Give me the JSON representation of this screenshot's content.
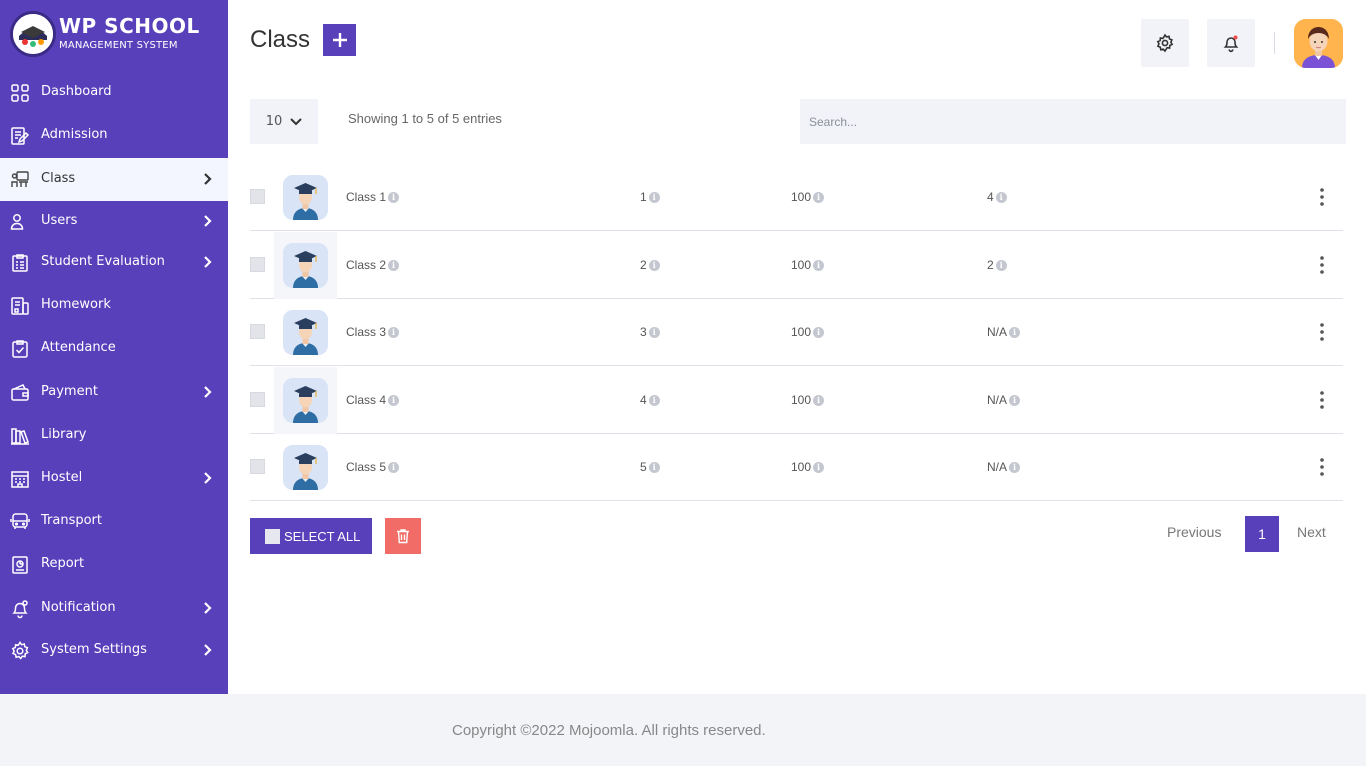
{
  "brand": {
    "title": "WP SCHOOL",
    "subtitle": "MANAGEMENT SYSTEM"
  },
  "sidebar": {
    "items": [
      {
        "label": "Dashboard",
        "icon": "grid-icon",
        "has_submenu": false,
        "active": false
      },
      {
        "label": "Admission",
        "icon": "edit-document-icon",
        "has_submenu": false,
        "active": false
      },
      {
        "label": "Class",
        "icon": "classroom-icon",
        "has_submenu": true,
        "active": true
      },
      {
        "label": "Users",
        "icon": "user-icon",
        "has_submenu": true,
        "active": false
      },
      {
        "label": "Student Evaluation",
        "icon": "clipboard-list-icon",
        "has_submenu": true,
        "active": false
      },
      {
        "label": "Homework",
        "icon": "homework-icon",
        "has_submenu": false,
        "active": false
      },
      {
        "label": "Attendance",
        "icon": "clipboard-check-icon",
        "has_submenu": false,
        "active": false
      },
      {
        "label": "Payment",
        "icon": "wallet-icon",
        "has_submenu": true,
        "active": false
      },
      {
        "label": "Library",
        "icon": "books-icon",
        "has_submenu": false,
        "active": false
      },
      {
        "label": "Hostel",
        "icon": "building-icon",
        "has_submenu": true,
        "active": false
      },
      {
        "label": "Transport",
        "icon": "bus-icon",
        "has_submenu": false,
        "active": false
      },
      {
        "label": "Report",
        "icon": "report-icon",
        "has_submenu": false,
        "active": false
      },
      {
        "label": "Notification",
        "icon": "bell-icon",
        "has_submenu": true,
        "active": false
      },
      {
        "label": "System Settings",
        "icon": "gear-icon",
        "has_submenu": true,
        "active": false
      }
    ]
  },
  "header": {
    "title": "Class",
    "add_icon": "plus-icon",
    "settings_icon": "gear-icon",
    "notification_icon": "bell-icon"
  },
  "table_controls": {
    "page_length": "10",
    "info": "Showing 1 to 5 of 5 entries",
    "search_placeholder": "Search..."
  },
  "rows": [
    {
      "name": "Class 1",
      "numeric": "1",
      "capacity": "100",
      "students": "4"
    },
    {
      "name": "Class 2",
      "numeric": "2",
      "capacity": "100",
      "students": "2"
    },
    {
      "name": "Class 3",
      "numeric": "3",
      "capacity": "100",
      "students": "N/A"
    },
    {
      "name": "Class 4",
      "numeric": "4",
      "capacity": "100",
      "students": "N/A"
    },
    {
      "name": "Class 5",
      "numeric": "5",
      "capacity": "100",
      "students": "N/A"
    }
  ],
  "actions": {
    "select_all": "SELECT ALL",
    "delete_icon": "trash-icon"
  },
  "pagination": {
    "previous": "Previous",
    "current": "1",
    "next": "Next"
  },
  "footer": {
    "copyright": "Copyright ©2022 Mojoomla. All rights reserved."
  },
  "colors": {
    "primary": "#5840bb",
    "danger": "#f16c66",
    "surface": "#f1f3f8"
  }
}
